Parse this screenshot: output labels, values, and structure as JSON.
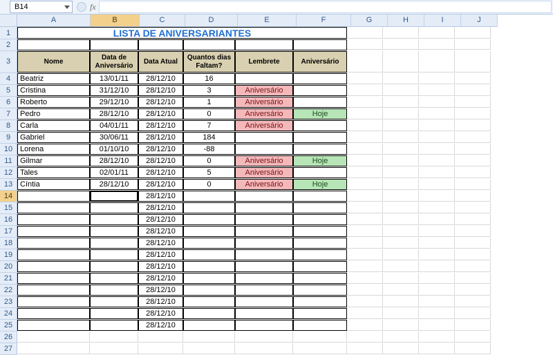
{
  "refbar": {
    "cell_ref": "B14",
    "fx_label": "fx",
    "formula": ""
  },
  "columns": [
    "A",
    "B",
    "C",
    "D",
    "E",
    "F",
    "G",
    "H",
    "I",
    "J"
  ],
  "selected_col": "B",
  "selected_row": 14,
  "title": "LISTA DE ANIVERSARIANTES",
  "headers": {
    "name": "Nome",
    "bday": "Data de Aniversário",
    "today": "Data Atual",
    "days": "Quantos dias Faltam?",
    "reminder": "Lembrete",
    "anniv": "Aniversário"
  },
  "today_fill": "28/12/10",
  "rows": [
    {
      "name": "Beatriz",
      "bday": "13/01/11",
      "today": "28/12/10",
      "days": "16",
      "reminder": "",
      "anniv": ""
    },
    {
      "name": "Cristina",
      "bday": "31/12/10",
      "today": "28/12/10",
      "days": "3",
      "reminder": "Aniversário",
      "anniv": ""
    },
    {
      "name": "Roberto",
      "bday": "29/12/10",
      "today": "28/12/10",
      "days": "1",
      "reminder": "Aniversário",
      "anniv": ""
    },
    {
      "name": "Pedro",
      "bday": "28/12/10",
      "today": "28/12/10",
      "days": "0",
      "reminder": "Aniversário",
      "anniv": "Hoje"
    },
    {
      "name": "Carla",
      "bday": "04/01/11",
      "today": "28/12/10",
      "days": "7",
      "reminder": "Aniversário",
      "anniv": ""
    },
    {
      "name": "Gabriel",
      "bday": "30/06/11",
      "today": "28/12/10",
      "days": "184",
      "reminder": "",
      "anniv": ""
    },
    {
      "name": "Lorena",
      "bday": "01/10/10",
      "today": "28/12/10",
      "days": "-88",
      "reminder": "",
      "anniv": ""
    },
    {
      "name": "Gilmar",
      "bday": "28/12/10",
      "today": "28/12/10",
      "days": "0",
      "reminder": "Aniversário",
      "anniv": "Hoje"
    },
    {
      "name": "Tales",
      "bday": "02/01/11",
      "today": "28/12/10",
      "days": "5",
      "reminder": "Aniversário",
      "anniv": ""
    },
    {
      "name": "Cíntia",
      "bday": "28/12/10",
      "today": "28/12/10",
      "days": "0",
      "reminder": "Aniversário",
      "anniv": "Hoje"
    }
  ],
  "extra_row_count": 12,
  "blank_row_count": 2
}
